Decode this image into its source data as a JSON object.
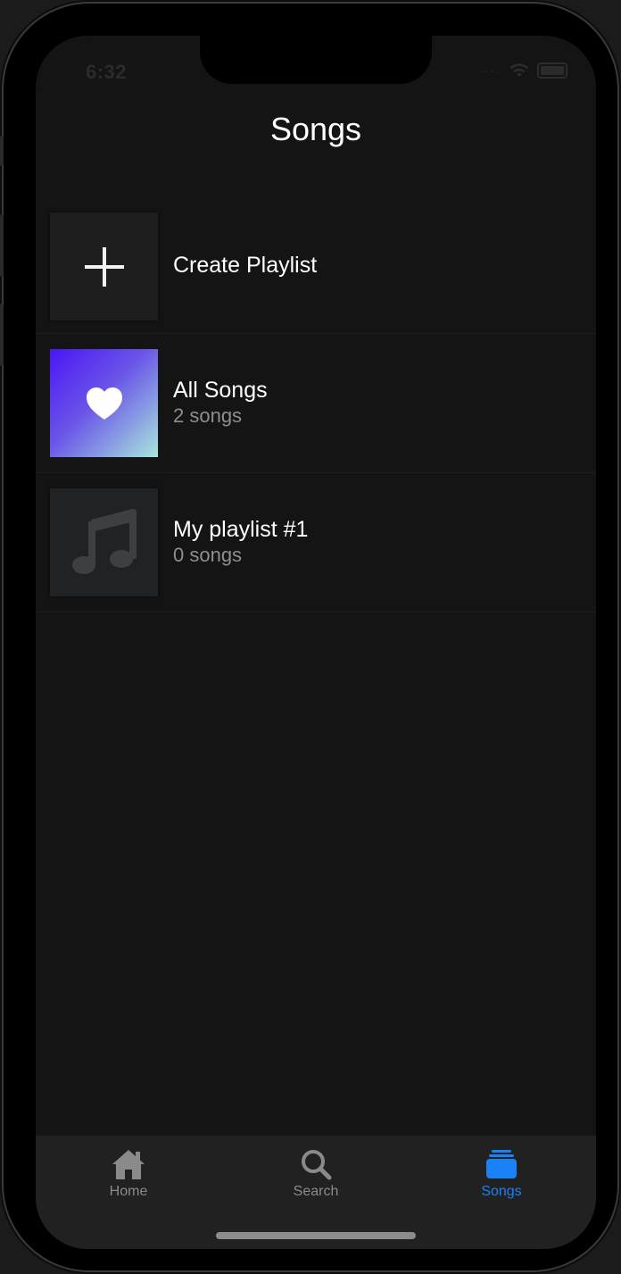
{
  "status_bar": {
    "time": "6:32"
  },
  "header": {
    "title": "Songs"
  },
  "playlists": [
    {
      "title": "Create Playlist",
      "subtitle": "",
      "icon": "plus-icon"
    },
    {
      "title": "All Songs",
      "subtitle": "2 songs",
      "icon": "heart-icon"
    },
    {
      "title": "My playlist #1",
      "subtitle": "0 songs",
      "icon": "music-note-icon"
    }
  ],
  "tabbar": {
    "tabs": [
      {
        "label": "Home",
        "icon": "home-icon",
        "active": false
      },
      {
        "label": "Search",
        "icon": "search-icon",
        "active": false
      },
      {
        "label": "Songs",
        "icon": "stack-icon",
        "active": true
      }
    ]
  },
  "colors": {
    "background": "#141414",
    "accent": "#1a82f7",
    "gradient_start": "#4a16f5",
    "gradient_end": "#a8e6dc"
  }
}
